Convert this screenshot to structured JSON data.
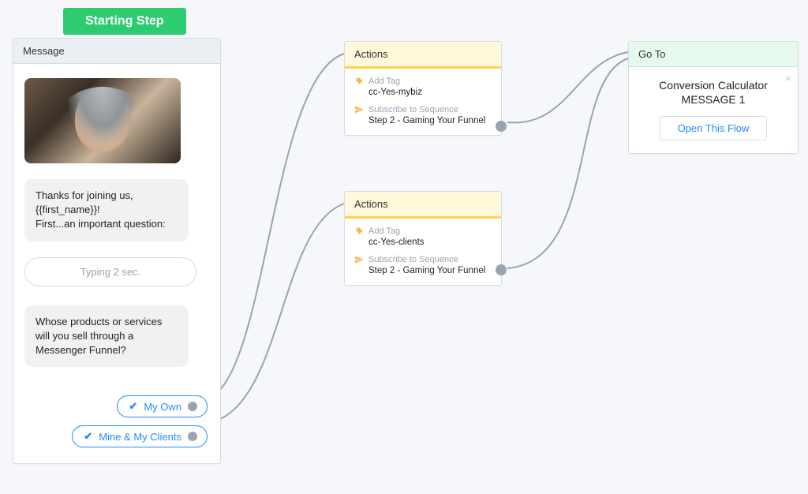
{
  "starting_step": "Starting Step",
  "message": {
    "header": "Message",
    "bubble1_line1": "Thanks for joining us,",
    "bubble1_line2": "{{first_name}}!",
    "bubble1_line3": "First...an important question:",
    "typing": "Typing 2 sec.",
    "bubble2": "Whose products or services will you sell through a Messenger Funnel?",
    "qr1": "My Own",
    "qr2": "Mine & My Clients"
  },
  "actions1": {
    "header": "Actions",
    "add_tag_label": "Add Tag",
    "add_tag_value": "cc-Yes-mybiz",
    "subscribe_label": "Subscribe to Sequence",
    "subscribe_value": "Step 2 - Gaming Your Funnel"
  },
  "actions2": {
    "header": "Actions",
    "add_tag_label": "Add Tag",
    "add_tag_value": "cc-Yes-clients",
    "subscribe_label": "Subscribe to Sequence",
    "subscribe_value": "Step 2 - Gaming Your Funnel"
  },
  "goto": {
    "header": "Go To",
    "title_line1": "Conversion Calculator",
    "title_line2": "MESSAGE 1",
    "button": "Open This Flow"
  }
}
